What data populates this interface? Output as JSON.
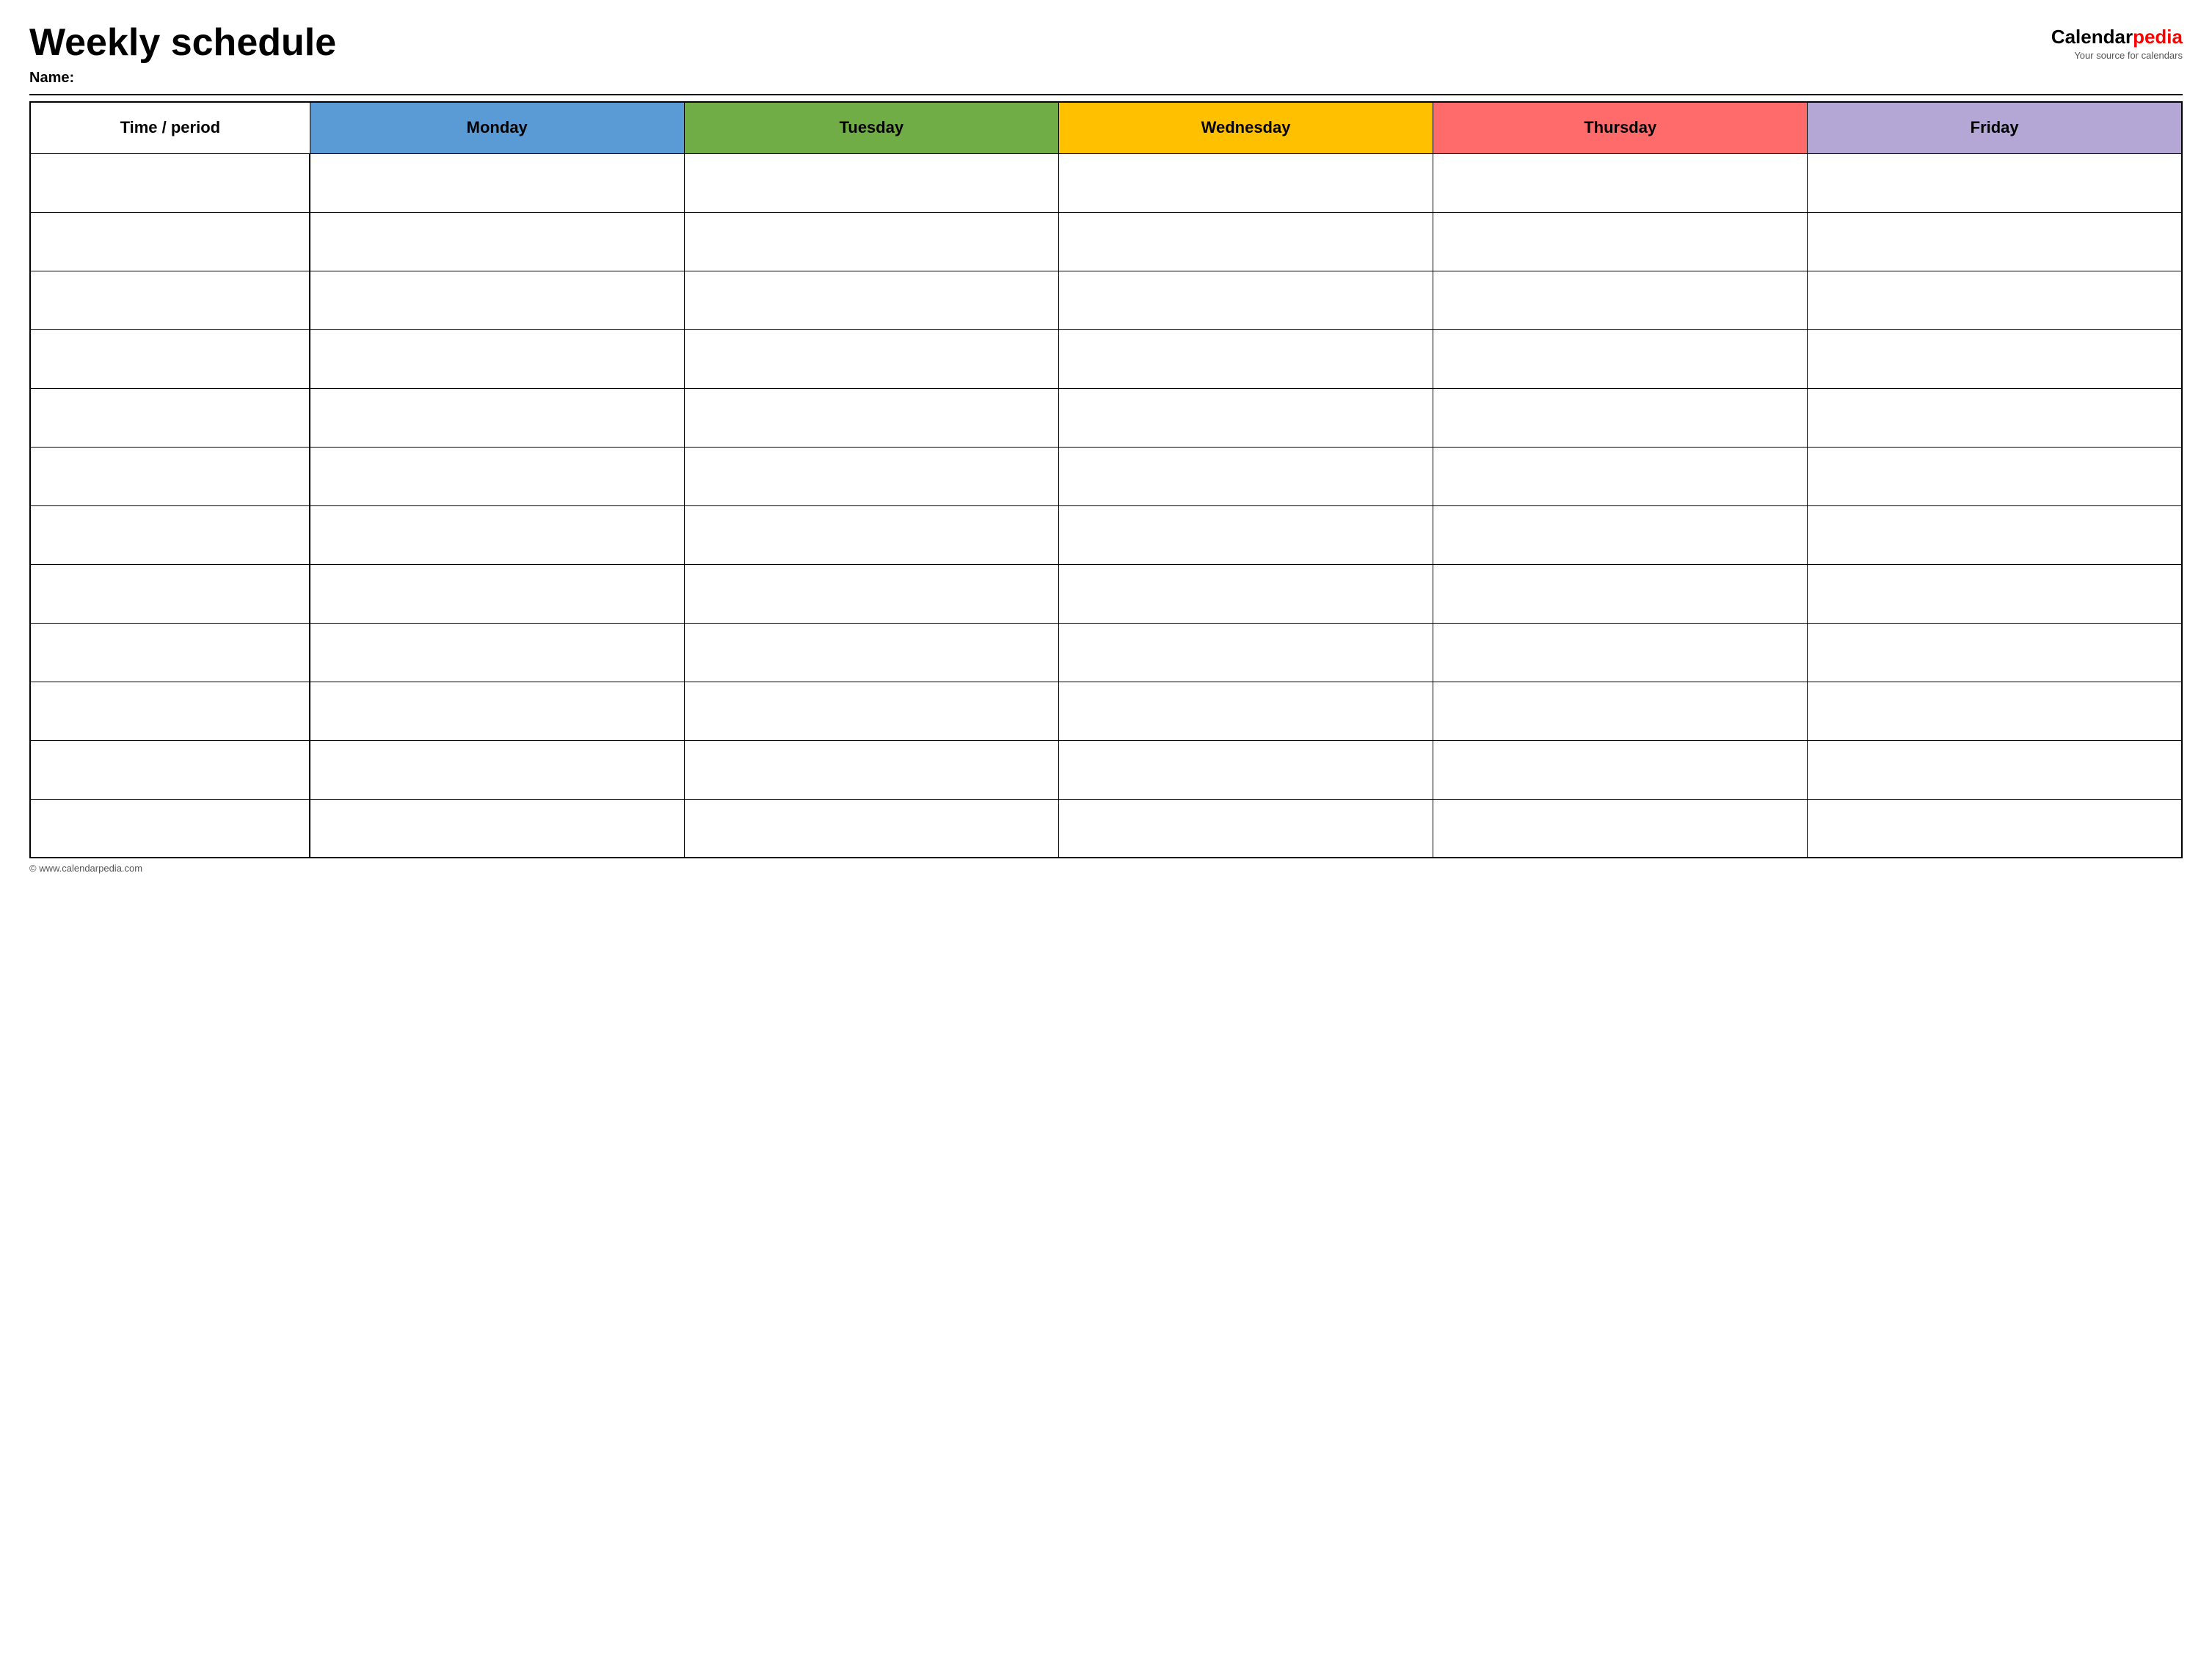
{
  "header": {
    "title": "Weekly schedule",
    "name_label": "Name:",
    "logo": {
      "calendar_part": "Calendar",
      "pedia_part": "pedia",
      "tagline": "Your source for calendars"
    }
  },
  "table": {
    "columns": [
      {
        "key": "time",
        "label": "Time / period",
        "color": "#ffffff",
        "text_color": "#000000"
      },
      {
        "key": "monday",
        "label": "Monday",
        "color": "#5b9bd5",
        "text_color": "#000000"
      },
      {
        "key": "tuesday",
        "label": "Tuesday",
        "color": "#70ad47",
        "text_color": "#000000"
      },
      {
        "key": "wednesday",
        "label": "Wednesday",
        "color": "#ffc000",
        "text_color": "#000000"
      },
      {
        "key": "thursday",
        "label": "Thursday",
        "color": "#ff6b6b",
        "text_color": "#000000"
      },
      {
        "key": "friday",
        "label": "Friday",
        "color": "#b4a7d6",
        "text_color": "#000000"
      }
    ],
    "row_count": 12
  },
  "footer": {
    "url": "© www.calendarpedia.com"
  }
}
